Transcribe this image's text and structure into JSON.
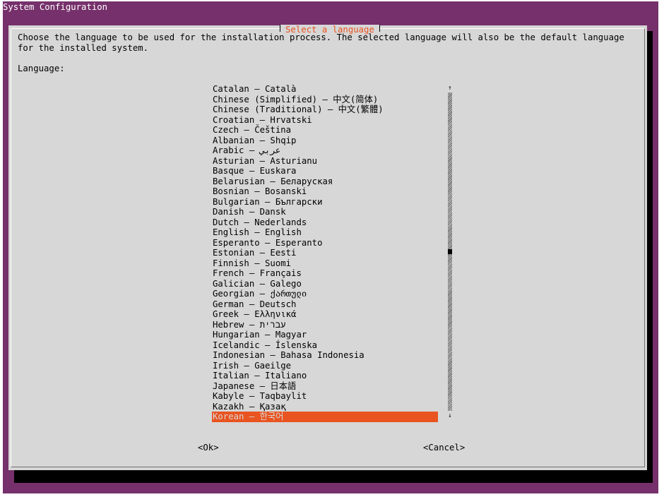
{
  "window": {
    "title": "System Configuration"
  },
  "dialog": {
    "title": "Select a language",
    "description": "Choose the language to be used for the installation process. The selected language will also be the default language for the installed system.",
    "list_label": "Language:",
    "selected_index": 32,
    "languages": [
      "Catalan – Català",
      "Chinese (Simplified) – 中文(简体)",
      "Chinese (Traditional) – 中文(繁體)",
      "Croatian – Hrvatski",
      "Czech – Čeština",
      "Albanian – Shqip",
      "Arabic – عربي",
      "Asturian – Asturianu",
      "Basque – Euskara",
      "Belarusian – Беларуская",
      "Bosnian – Bosanski",
      "Bulgarian – Български",
      "Danish – Dansk",
      "Dutch – Nederlands",
      "English – English",
      "Esperanto – Esperanto",
      "Estonian – Eesti",
      "Finnish – Suomi",
      "French – Français",
      "Galician – Galego",
      "Georgian – ქართული",
      "German – Deutsch",
      "Greek – Ελληνικά",
      "Hebrew – עברית",
      "Hungarian – Magyar",
      "Icelandic – Íslenska",
      "Indonesian – Bahasa Indonesia",
      "Irish – Gaeilge",
      "Italian – Italiano",
      "Japanese – 日本語",
      "Kabyle – Taqbaylit",
      "Kazakh – Қазақ",
      "Korean – 한국어"
    ],
    "scroll": {
      "up_icon": "↑",
      "down_icon": "↓",
      "position_fraction": 0.5
    },
    "buttons": {
      "ok": "<Ok>",
      "cancel": "<Cancel>"
    }
  },
  "colors": {
    "background": "#76306b",
    "dialog": "#d7d7d7",
    "accent": "#e95420",
    "shadow": "#000000"
  }
}
